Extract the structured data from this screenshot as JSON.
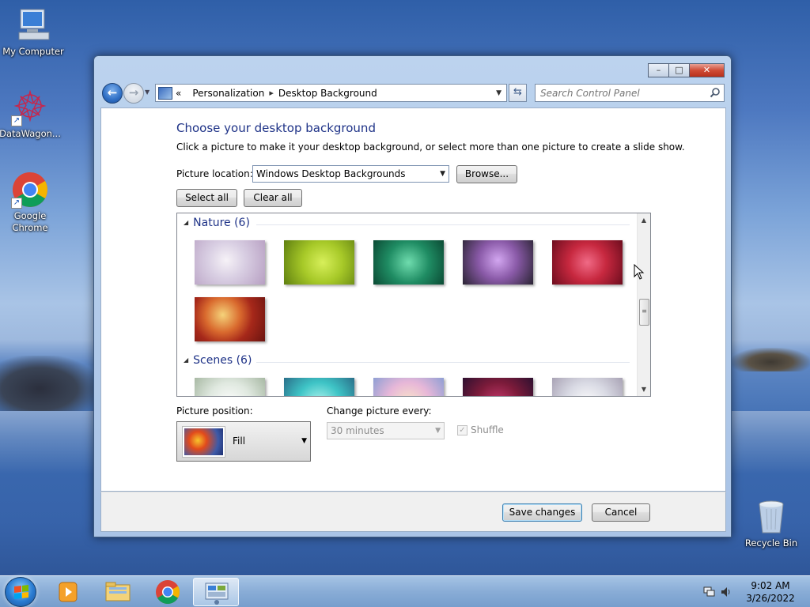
{
  "desktop": {
    "icons": [
      {
        "label": "My Computer"
      },
      {
        "label": "DataWagon..."
      },
      {
        "label": "Google Chrome"
      },
      {
        "label": "Recycle Bin"
      }
    ]
  },
  "window": {
    "controls": {
      "minimize": "–",
      "maximize": "□",
      "close": "✕"
    },
    "breadcrumb": {
      "prefix": "«",
      "items": [
        "Personalization",
        "Desktop Background"
      ],
      "separator": "▸"
    },
    "search": {
      "placeholder": "Search Control Panel"
    },
    "title": "Choose your desktop background",
    "description": "Click a picture to make it your desktop background, or select more than one picture to create a slide show.",
    "picture_location": {
      "label": "Picture location:",
      "value": "Windows Desktop Backgrounds",
      "browse_label": "Browse..."
    },
    "select_all_label": "Select all",
    "clear_all_label": "Clear all",
    "groups": [
      {
        "label": "Nature (6)",
        "thumb_colors": [
          "#d9cfe3",
          "#a7c928",
          "#1f8c63",
          "#8a5aa8",
          "#c7283f",
          "#a6281a"
        ]
      },
      {
        "label": "Scenes (6)",
        "thumb_colors": [
          "#dfe8df",
          "#3ec4c6",
          "#e7b7d8",
          "#7c1b3a",
          "#d8d9e3"
        ]
      }
    ],
    "picture_position": {
      "label": "Picture position:",
      "value": "Fill"
    },
    "change_every": {
      "label": "Change picture every:",
      "value": "30 minutes"
    },
    "shuffle": {
      "label": "Shuffle",
      "checked": true
    },
    "save_label": "Save changes",
    "cancel_label": "Cancel"
  },
  "taskbar": {
    "time": "9:02 AM",
    "date": "3/26/2022"
  },
  "colors": {
    "accent_title": "#1e3287",
    "desktop_sky": "#4d78c0"
  }
}
